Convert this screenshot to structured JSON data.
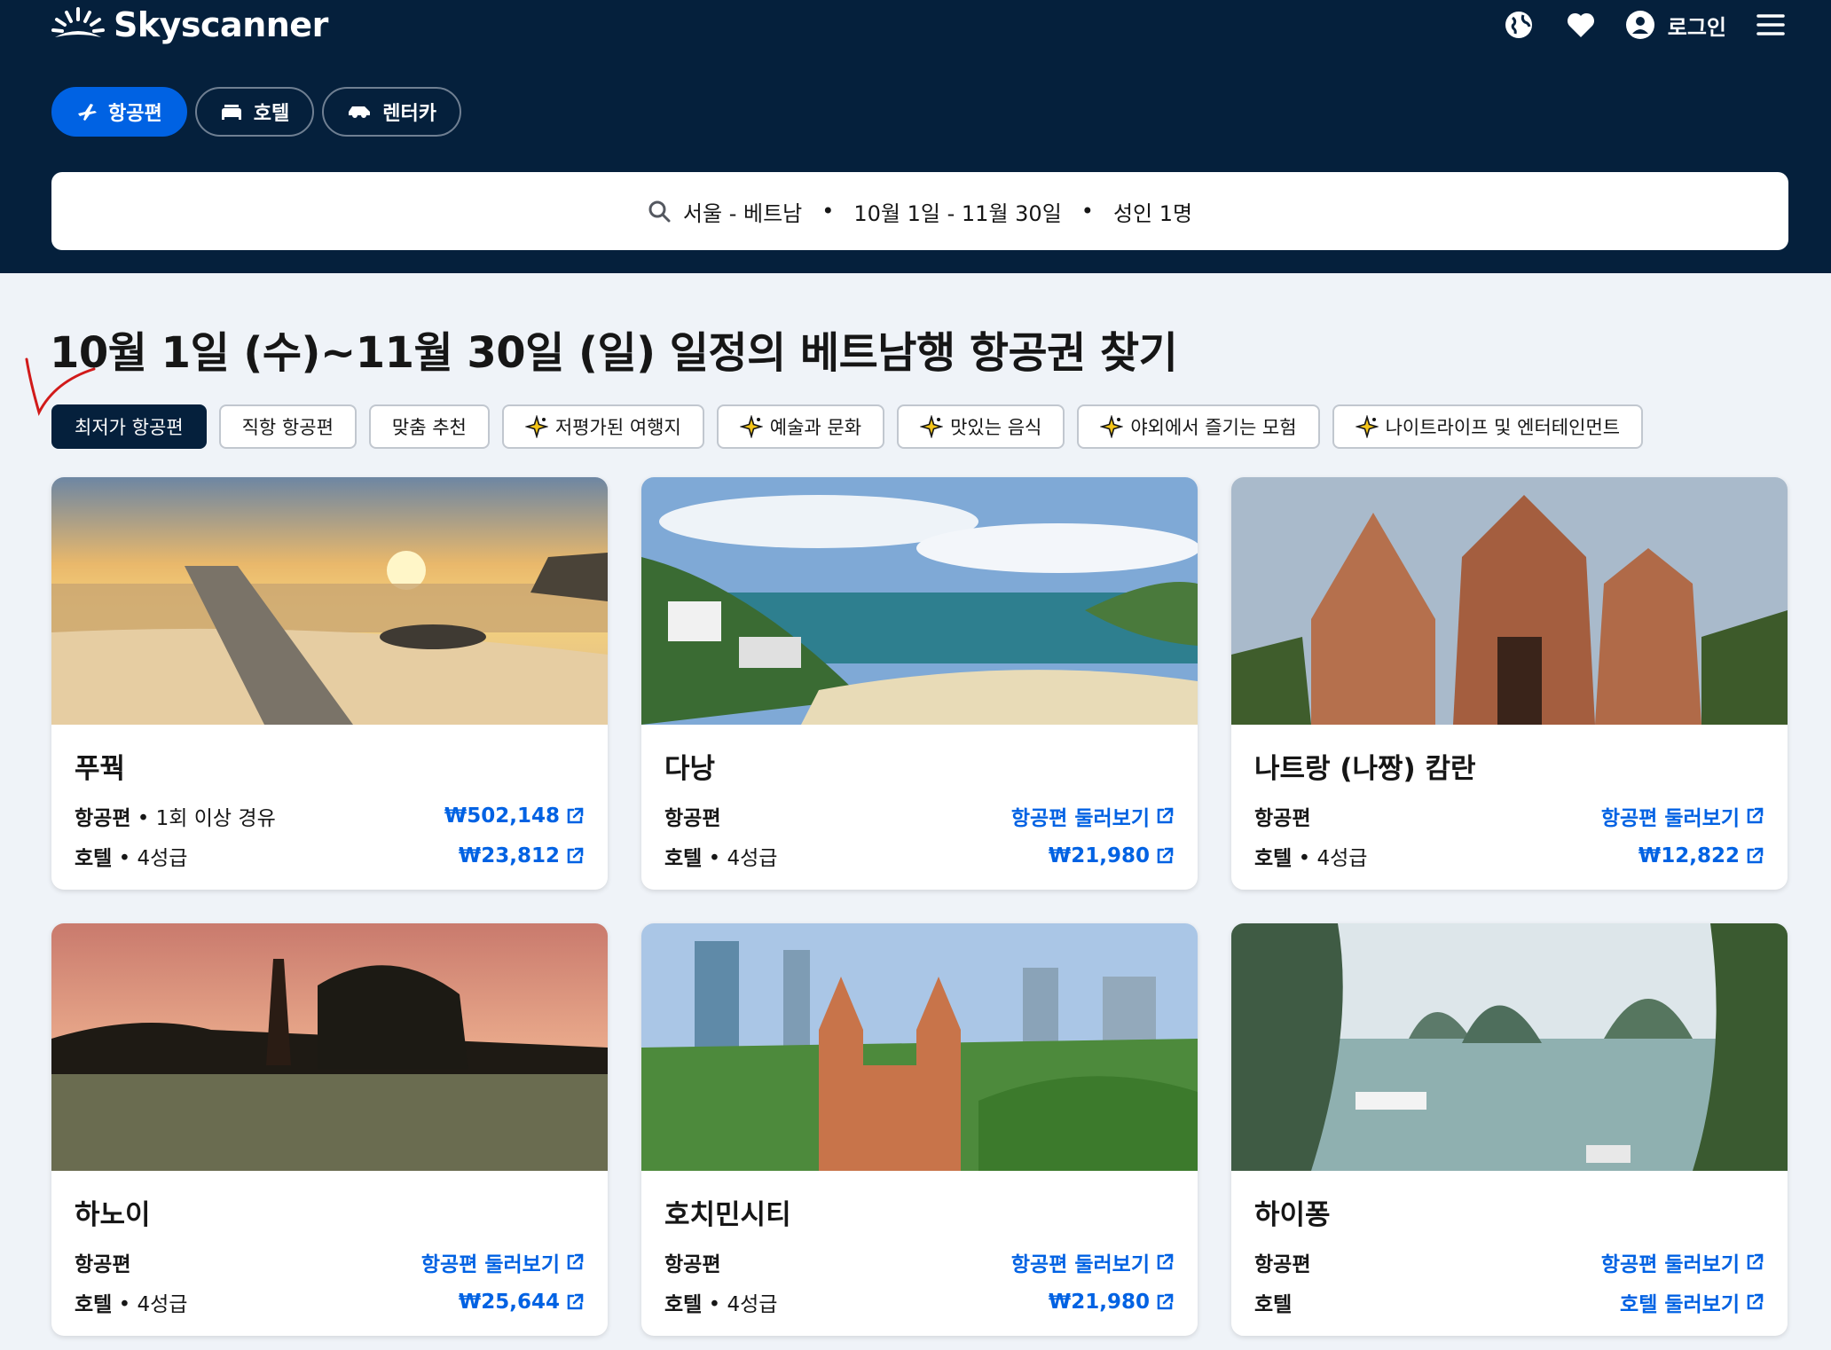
{
  "header": {
    "logo_text": "Skyscanner",
    "login_label": "로그인",
    "tabs": [
      {
        "label": "항공편",
        "icon": "plane-icon",
        "active": true
      },
      {
        "label": "호텔",
        "icon": "bed-icon",
        "active": false
      },
      {
        "label": "렌터카",
        "icon": "car-icon",
        "active": false
      }
    ],
    "search": {
      "route": "서울 - 베트남",
      "dates": "10월 1일 - 11월 30일",
      "travellers": "성인 1명",
      "separator": "•"
    }
  },
  "main": {
    "title": "10월 1일 (수)~11월 30일 (일) 일정의 베트남행 항공권 찾기",
    "filters": [
      {
        "label": "최저가 항공편",
        "active": true,
        "sparkle": false
      },
      {
        "label": "직항 항공편",
        "active": false,
        "sparkle": false
      },
      {
        "label": "맞춤 추천",
        "active": false,
        "sparkle": false
      },
      {
        "label": "저평가된 여행지",
        "active": false,
        "sparkle": true
      },
      {
        "label": "예술과 문화",
        "active": false,
        "sparkle": true
      },
      {
        "label": "맛있는 음식",
        "active": false,
        "sparkle": true
      },
      {
        "label": "야외에서 즐기는 모험",
        "active": false,
        "sparkle": true
      },
      {
        "label": "나이트라이프 및 엔터테인먼트",
        "active": false,
        "sparkle": true
      }
    ],
    "cards": [
      {
        "name": "푸꿕",
        "flight_label": "항공편",
        "flight_detail": " • 1회 이상 경유",
        "flight_value": "₩502,148",
        "hotel_label": "호텔",
        "hotel_detail": " • 4성급",
        "hotel_value": "₩23,812"
      },
      {
        "name": "다낭",
        "flight_label": "항공편",
        "flight_detail": "",
        "flight_value": "항공편 둘러보기",
        "hotel_label": "호텔",
        "hotel_detail": " • 4성급",
        "hotel_value": "₩21,980"
      },
      {
        "name": "나트랑 (나짱) 캄란",
        "flight_label": "항공편",
        "flight_detail": "",
        "flight_value": "항공편 둘러보기",
        "hotel_label": "호텔",
        "hotel_detail": " • 4성급",
        "hotel_value": "₩12,822"
      },
      {
        "name": "하노이",
        "flight_label": "항공편",
        "flight_detail": "",
        "flight_value": "항공편 둘러보기",
        "hotel_label": "호텔",
        "hotel_detail": " • 4성급",
        "hotel_value": "₩25,644"
      },
      {
        "name": "호치민시티",
        "flight_label": "항공편",
        "flight_detail": "",
        "flight_value": "항공편 둘러보기",
        "hotel_label": "호텔",
        "hotel_detail": " • 4성급",
        "hotel_value": "₩21,980"
      },
      {
        "name": "하이퐁",
        "flight_label": "항공편",
        "flight_detail": "",
        "flight_value": "항공편 둘러보기",
        "hotel_label": "호텔",
        "hotel_detail": "",
        "hotel_value": "호텔 둘러보기"
      }
    ]
  },
  "colors": {
    "header_bg": "#05203c",
    "accent": "#0062e3",
    "page_bg": "#eff3f8"
  }
}
